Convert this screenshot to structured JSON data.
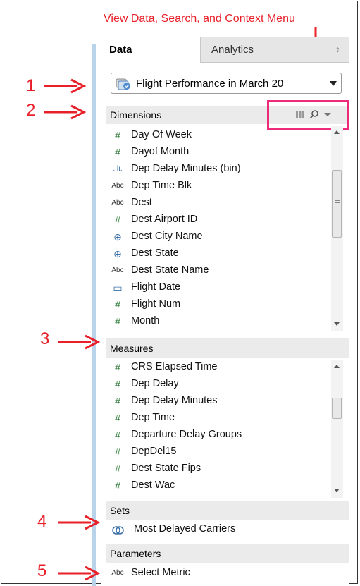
{
  "annotation": {
    "top_label": "View Data, Search, and Context Menu",
    "numbers": [
      "1",
      "2",
      "3",
      "4",
      "5"
    ],
    "color": "#e8202a",
    "highlight_color": "#ee2a7b"
  },
  "tabs": [
    {
      "label": "Data",
      "active": true
    },
    {
      "label": "Analytics",
      "active": false
    }
  ],
  "datasource": {
    "label": "Flight Performance in March 20",
    "icon": "database-icon"
  },
  "dimensions": {
    "header": "Dimensions",
    "tools": [
      "view-data-icon",
      "search-icon",
      "chevron-down-icon"
    ],
    "items": [
      {
        "icon": "#",
        "type": "number",
        "label": "Day Of Week"
      },
      {
        "icon": "#",
        "type": "number",
        "label": "Dayof Month"
      },
      {
        "icon": ".ılı.",
        "type": "bin",
        "label": "Dep Delay Minutes (bin)"
      },
      {
        "icon": "Abc",
        "type": "string",
        "label": "Dep Time Blk"
      },
      {
        "icon": "Abc",
        "type": "string",
        "label": "Dest"
      },
      {
        "icon": "#",
        "type": "number",
        "label": "Dest Airport ID"
      },
      {
        "icon": "⊕",
        "type": "geo",
        "label": "Dest City Name"
      },
      {
        "icon": "⊕",
        "type": "geo",
        "label": "Dest State"
      },
      {
        "icon": "Abc",
        "type": "string",
        "label": "Dest State Name"
      },
      {
        "icon": "▭",
        "type": "date",
        "label": "Flight Date"
      },
      {
        "icon": "#",
        "type": "number",
        "label": "Flight Num"
      },
      {
        "icon": "#",
        "type": "number",
        "label": "Month"
      }
    ]
  },
  "measures": {
    "header": "Measures",
    "items": [
      {
        "icon": "#",
        "label": "CRS Elapsed Time"
      },
      {
        "icon": "#",
        "label": "Dep Delay"
      },
      {
        "icon": "#",
        "label": "Dep Delay Minutes"
      },
      {
        "icon": "#",
        "label": "Dep Time"
      },
      {
        "icon": "#",
        "label": "Departure Delay Groups"
      },
      {
        "icon": "#",
        "label": "DepDel15"
      },
      {
        "icon": "#",
        "label": "Dest State Fips"
      },
      {
        "icon": "#",
        "label": "Dest Wac"
      }
    ]
  },
  "sets": {
    "header": "Sets",
    "items": [
      {
        "icon": "set-icon",
        "label": "Most Delayed Carriers"
      }
    ]
  },
  "parameters": {
    "header": "Parameters",
    "items": [
      {
        "icon": "Abc",
        "label": "Select Metric"
      }
    ]
  }
}
